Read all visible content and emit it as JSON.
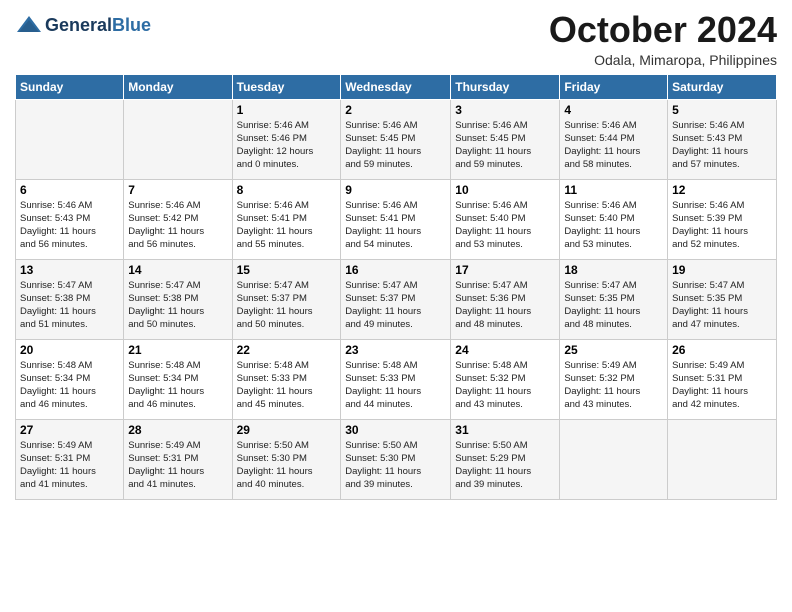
{
  "logo": {
    "line1": "General",
    "line2": "Blue"
  },
  "title": "October 2024",
  "location": "Odala, Mimaropa, Philippines",
  "days_of_week": [
    "Sunday",
    "Monday",
    "Tuesday",
    "Wednesday",
    "Thursday",
    "Friday",
    "Saturday"
  ],
  "weeks": [
    [
      {
        "num": "",
        "detail": ""
      },
      {
        "num": "",
        "detail": ""
      },
      {
        "num": "1",
        "detail": "Sunrise: 5:46 AM\nSunset: 5:46 PM\nDaylight: 12 hours\nand 0 minutes."
      },
      {
        "num": "2",
        "detail": "Sunrise: 5:46 AM\nSunset: 5:45 PM\nDaylight: 11 hours\nand 59 minutes."
      },
      {
        "num": "3",
        "detail": "Sunrise: 5:46 AM\nSunset: 5:45 PM\nDaylight: 11 hours\nand 59 minutes."
      },
      {
        "num": "4",
        "detail": "Sunrise: 5:46 AM\nSunset: 5:44 PM\nDaylight: 11 hours\nand 58 minutes."
      },
      {
        "num": "5",
        "detail": "Sunrise: 5:46 AM\nSunset: 5:43 PM\nDaylight: 11 hours\nand 57 minutes."
      }
    ],
    [
      {
        "num": "6",
        "detail": "Sunrise: 5:46 AM\nSunset: 5:43 PM\nDaylight: 11 hours\nand 56 minutes."
      },
      {
        "num": "7",
        "detail": "Sunrise: 5:46 AM\nSunset: 5:42 PM\nDaylight: 11 hours\nand 56 minutes."
      },
      {
        "num": "8",
        "detail": "Sunrise: 5:46 AM\nSunset: 5:41 PM\nDaylight: 11 hours\nand 55 minutes."
      },
      {
        "num": "9",
        "detail": "Sunrise: 5:46 AM\nSunset: 5:41 PM\nDaylight: 11 hours\nand 54 minutes."
      },
      {
        "num": "10",
        "detail": "Sunrise: 5:46 AM\nSunset: 5:40 PM\nDaylight: 11 hours\nand 53 minutes."
      },
      {
        "num": "11",
        "detail": "Sunrise: 5:46 AM\nSunset: 5:40 PM\nDaylight: 11 hours\nand 53 minutes."
      },
      {
        "num": "12",
        "detail": "Sunrise: 5:46 AM\nSunset: 5:39 PM\nDaylight: 11 hours\nand 52 minutes."
      }
    ],
    [
      {
        "num": "13",
        "detail": "Sunrise: 5:47 AM\nSunset: 5:38 PM\nDaylight: 11 hours\nand 51 minutes."
      },
      {
        "num": "14",
        "detail": "Sunrise: 5:47 AM\nSunset: 5:38 PM\nDaylight: 11 hours\nand 50 minutes."
      },
      {
        "num": "15",
        "detail": "Sunrise: 5:47 AM\nSunset: 5:37 PM\nDaylight: 11 hours\nand 50 minutes."
      },
      {
        "num": "16",
        "detail": "Sunrise: 5:47 AM\nSunset: 5:37 PM\nDaylight: 11 hours\nand 49 minutes."
      },
      {
        "num": "17",
        "detail": "Sunrise: 5:47 AM\nSunset: 5:36 PM\nDaylight: 11 hours\nand 48 minutes."
      },
      {
        "num": "18",
        "detail": "Sunrise: 5:47 AM\nSunset: 5:35 PM\nDaylight: 11 hours\nand 48 minutes."
      },
      {
        "num": "19",
        "detail": "Sunrise: 5:47 AM\nSunset: 5:35 PM\nDaylight: 11 hours\nand 47 minutes."
      }
    ],
    [
      {
        "num": "20",
        "detail": "Sunrise: 5:48 AM\nSunset: 5:34 PM\nDaylight: 11 hours\nand 46 minutes."
      },
      {
        "num": "21",
        "detail": "Sunrise: 5:48 AM\nSunset: 5:34 PM\nDaylight: 11 hours\nand 46 minutes."
      },
      {
        "num": "22",
        "detail": "Sunrise: 5:48 AM\nSunset: 5:33 PM\nDaylight: 11 hours\nand 45 minutes."
      },
      {
        "num": "23",
        "detail": "Sunrise: 5:48 AM\nSunset: 5:33 PM\nDaylight: 11 hours\nand 44 minutes."
      },
      {
        "num": "24",
        "detail": "Sunrise: 5:48 AM\nSunset: 5:32 PM\nDaylight: 11 hours\nand 43 minutes."
      },
      {
        "num": "25",
        "detail": "Sunrise: 5:49 AM\nSunset: 5:32 PM\nDaylight: 11 hours\nand 43 minutes."
      },
      {
        "num": "26",
        "detail": "Sunrise: 5:49 AM\nSunset: 5:31 PM\nDaylight: 11 hours\nand 42 minutes."
      }
    ],
    [
      {
        "num": "27",
        "detail": "Sunrise: 5:49 AM\nSunset: 5:31 PM\nDaylight: 11 hours\nand 41 minutes."
      },
      {
        "num": "28",
        "detail": "Sunrise: 5:49 AM\nSunset: 5:31 PM\nDaylight: 11 hours\nand 41 minutes."
      },
      {
        "num": "29",
        "detail": "Sunrise: 5:50 AM\nSunset: 5:30 PM\nDaylight: 11 hours\nand 40 minutes."
      },
      {
        "num": "30",
        "detail": "Sunrise: 5:50 AM\nSunset: 5:30 PM\nDaylight: 11 hours\nand 39 minutes."
      },
      {
        "num": "31",
        "detail": "Sunrise: 5:50 AM\nSunset: 5:29 PM\nDaylight: 11 hours\nand 39 minutes."
      },
      {
        "num": "",
        "detail": ""
      },
      {
        "num": "",
        "detail": ""
      }
    ]
  ]
}
